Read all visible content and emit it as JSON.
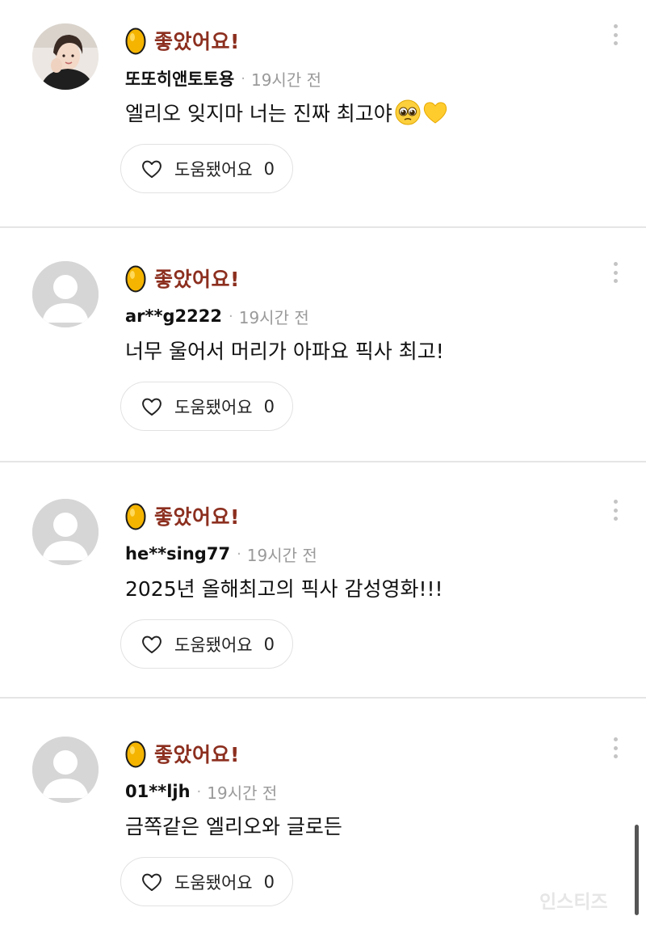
{
  "reviews": [
    {
      "rating_label": "좋았어요!",
      "username": "또또히앤토토용",
      "separator": "·",
      "time": "19시간 전",
      "comment": "엘리오 잊지마 너는 진짜 최고야",
      "comment_emojis": [
        "pleading-face-icon",
        "yellow-heart-icon"
      ],
      "helpful_label": "도움됐어요",
      "helpful_count": "0",
      "avatar": "profile-photo"
    },
    {
      "rating_label": "좋았어요!",
      "username": "ar**g2222",
      "separator": "·",
      "time": "19시간 전",
      "comment": "너무 울어서 머리가 아파요 픽사 최고!",
      "helpful_label": "도움됐어요",
      "helpful_count": "0",
      "avatar": "default-avatar"
    },
    {
      "rating_label": "좋았어요!",
      "username": "he**sing77",
      "separator": "·",
      "time": "19시간 전",
      "comment": "2025년 올해최고의 픽사 감성영화!!!",
      "helpful_label": "도움됐어요",
      "helpful_count": "0",
      "avatar": "default-avatar"
    },
    {
      "rating_label": "좋았어요!",
      "username": "01**ljh",
      "separator": "·",
      "time": "19시간 전",
      "comment": "금쪽같은 엘리오와 글로든",
      "helpful_label": "도움됐어요",
      "helpful_count": "0",
      "avatar": "default-avatar"
    }
  ],
  "watermark": "인스티즈",
  "colors": {
    "rating_text": "#8c2f1f",
    "egg_fill": "#f4b400",
    "divider": "#e5e5e5",
    "time_text": "#9a9a9a"
  },
  "icons": [
    "golden-egg-icon",
    "heart-outline-icon",
    "more-options-icon",
    "default-avatar-icon"
  ]
}
